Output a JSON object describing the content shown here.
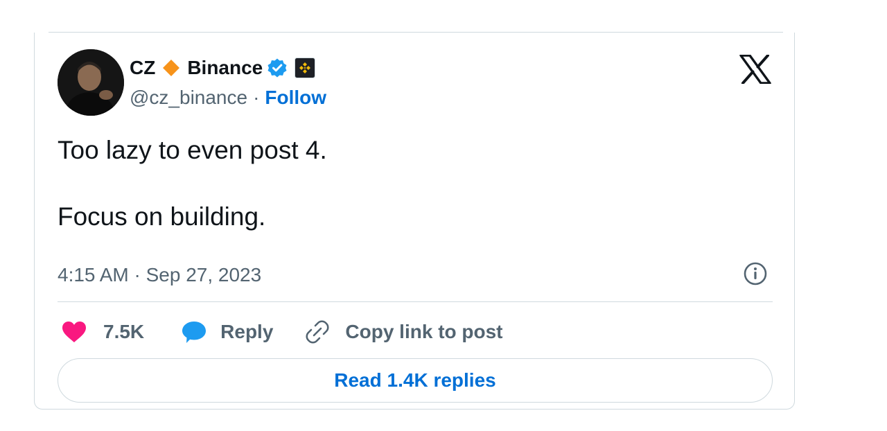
{
  "author": {
    "display_name": "CZ",
    "org_name": "Binance",
    "handle": "@cz_binance",
    "separator": "·",
    "follow_label": "Follow"
  },
  "icons": {
    "diamond": "orange-diamond-icon",
    "verified": "verified-badge-icon",
    "affiliate": "binance-affiliate-badge-icon",
    "platform": "x-logo-icon",
    "info": "info-icon",
    "like": "heart-icon",
    "reply": "speech-bubble-icon",
    "copy": "link-icon"
  },
  "tweet": {
    "line1": "Too lazy to even post 4.",
    "line2": "Focus on building.",
    "timestamp": "4:15 AM · Sep 27, 2023"
  },
  "actions": {
    "likes": "7.5K",
    "reply_label": "Reply",
    "copy_label": "Copy link to post"
  },
  "read_replies_label": "Read 1.4K replies",
  "colors": {
    "accent_blue": "#006fd6",
    "heart_pink": "#f91880",
    "reply_blue": "#1d9bf0",
    "diamond_orange": "#f7931a",
    "binance_yellow": "#f0b90b",
    "muted_text": "#536471",
    "border": "#cfd9de"
  }
}
